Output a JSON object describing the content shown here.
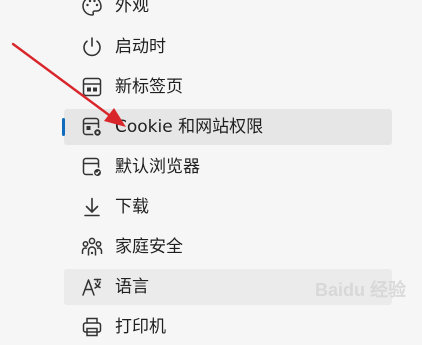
{
  "menu": {
    "items": [
      {
        "label": "外观",
        "icon": "palette-icon"
      },
      {
        "label": "启动时",
        "icon": "power-icon"
      },
      {
        "label": "新标签页",
        "icon": "new-tab-page-icon"
      },
      {
        "label": "Cookie 和网站权限",
        "icon": "cookie-site-permissions-icon",
        "selected": true
      },
      {
        "label": "默认浏览器",
        "icon": "default-browser-icon"
      },
      {
        "label": "下载",
        "icon": "download-icon"
      },
      {
        "label": "家庭安全",
        "icon": "family-safety-icon"
      },
      {
        "label": "语言",
        "icon": "language-icon",
        "hovered": true
      },
      {
        "label": "打印机",
        "icon": "printer-icon"
      }
    ]
  },
  "colors": {
    "accent": "#0f6cbd",
    "annotation_arrow": "#d9262b",
    "selected_background": "#e6e6e6"
  },
  "watermark": {
    "text": "Baidu 经验"
  }
}
